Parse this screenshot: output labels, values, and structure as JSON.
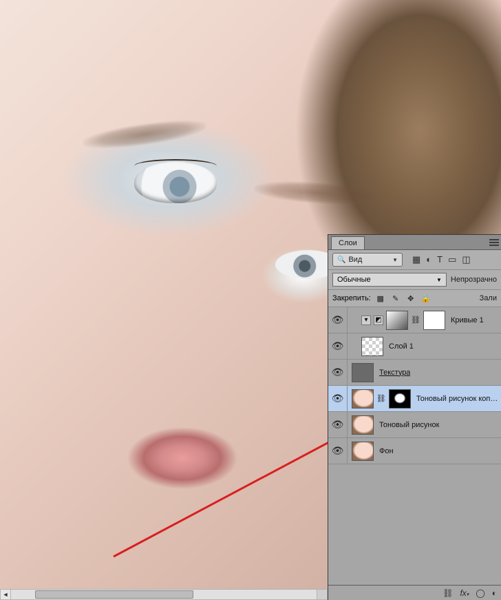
{
  "panel": {
    "tab_label": "Слои",
    "search_kind": "Вид",
    "blend_mode": "Обычные",
    "opacity_label": "Непрозрачно",
    "lock_label": "Закрепить:",
    "fill_label": "Зали",
    "filter_icons": [
      "image-filter-icon",
      "adjustment-filter-icon",
      "type-filter-icon",
      "shape-filter-icon",
      "smart-filter-icon"
    ]
  },
  "layers": [
    {
      "name": "Кривые 1",
      "selected": false,
      "indent": true,
      "pre_icons": [
        "chevron-down-icon",
        "adjustment-icon"
      ],
      "thumbs": [
        "adj",
        "mask"
      ],
      "link": true
    },
    {
      "name": "Слой 1",
      "selected": false,
      "indent": true,
      "pre_icons": [],
      "thumbs": [
        "checker"
      ],
      "link": false
    },
    {
      "name": "Текстура",
      "selected": false,
      "indent": false,
      "pre_icons": [],
      "thumbs": [
        "tex"
      ],
      "link": false,
      "underline": true
    },
    {
      "name": "Тоновый рисунок копия",
      "selected": true,
      "indent": false,
      "pre_icons": [],
      "thumbs": [
        "face",
        "mask-inv"
      ],
      "link": true
    },
    {
      "name": "Тоновый рисунок",
      "selected": false,
      "indent": false,
      "pre_icons": [],
      "thumbs": [
        "face"
      ],
      "link": false
    },
    {
      "name": "Фон",
      "selected": false,
      "indent": false,
      "pre_icons": [],
      "thumbs": [
        "face"
      ],
      "link": false
    }
  ],
  "footer_icons": [
    "link-icon",
    "fx-icon",
    "mask-icon",
    "adjustment-icon",
    "group-icon",
    "new-layer-icon"
  ]
}
